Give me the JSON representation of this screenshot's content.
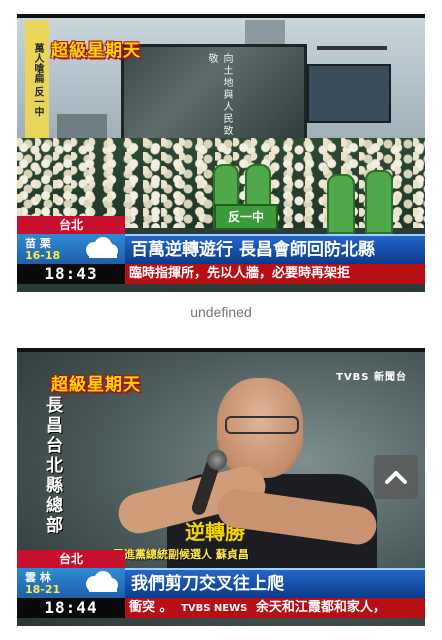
{
  "frame1": {
    "show_title": "超級星期天",
    "banner_vertical": "萬人嗆扁 反一中",
    "screen_text": "向土地與人民致敬",
    "cactus_sign": "反一中",
    "city": "台北",
    "weather_city": "苗 栗",
    "weather_temp": "16-18",
    "clock": "18:43",
    "headline": "百萬逆轉遊行 長昌會師回防北縣",
    "ticker": "臨時指揮所，先以人牆，必要時再架拒"
  },
  "caption_text": "undefined",
  "frame2": {
    "show_title": "超級星期天",
    "side_vertical": "長昌台北縣總部",
    "logo": "TVBS 新聞台",
    "shirt_text": "逆轉勝",
    "speaker_caption": "民進黨總統副候選人 蘇貞昌",
    "city": "台北",
    "weather_city": "雲 林",
    "weather_temp": "18-21",
    "clock": "18:44",
    "headline": "我們剪刀交叉往上爬",
    "ticker_left": "衝突 。",
    "ticker_brand": "TVBS NEWS",
    "ticker_right": "余天和江霞都和家人，"
  },
  "scroll_top_button": {
    "icon": "chevron-up-icon"
  },
  "colors": {
    "headline_blue": "#0b3a8c",
    "ticker_red": "#b80f14",
    "title_yellow": "#ffd400"
  }
}
